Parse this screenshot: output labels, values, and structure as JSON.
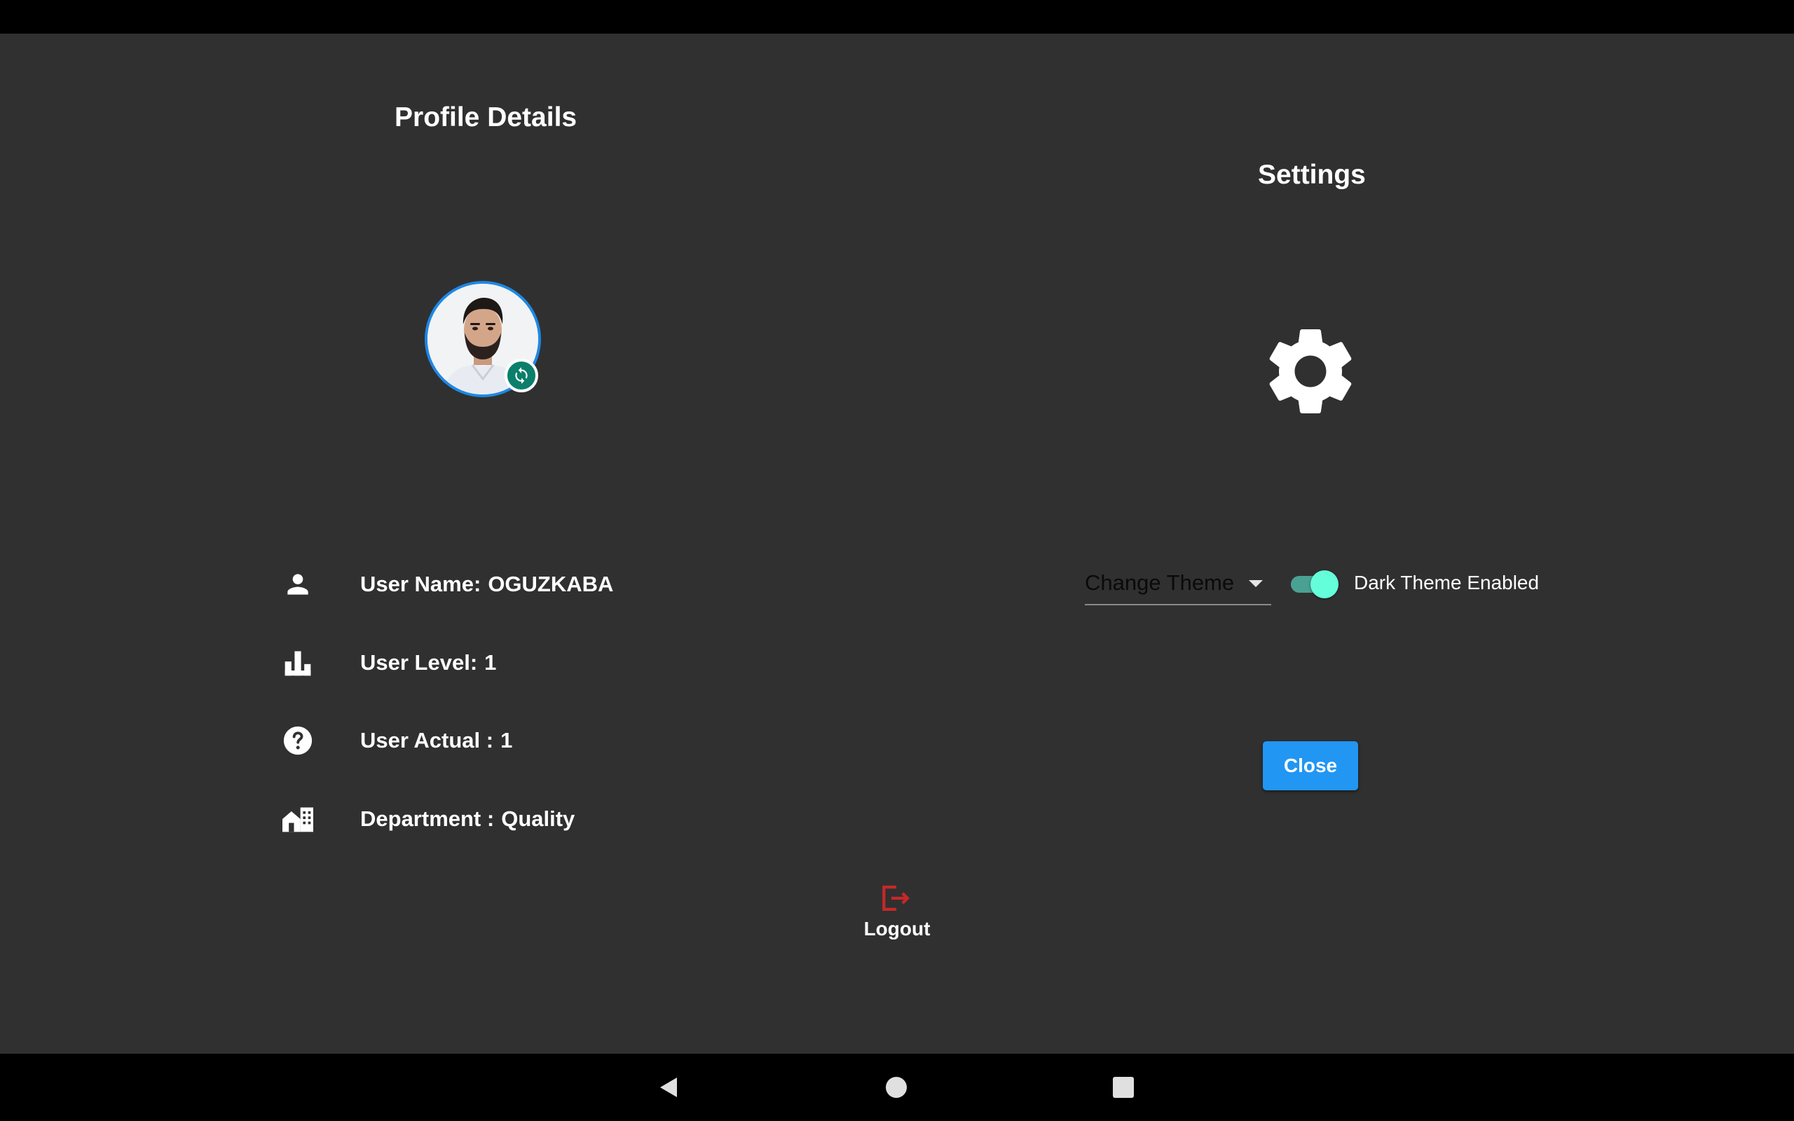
{
  "profile": {
    "title": "Profile Details",
    "user_name_label": "User Name:",
    "user_name_value": "OGUZKABA",
    "user_level_label": "User Level:",
    "user_level_value": "1",
    "user_actual_label": "User Actual :",
    "user_actual_value": "1",
    "department_label": "Department :",
    "department_value": "Quality"
  },
  "settings": {
    "title": "Settings",
    "theme_dropdown_label": "Change Theme",
    "dark_theme_label": "Dark Theme Enabled",
    "dark_theme_enabled": true,
    "close_label": "Close"
  },
  "logout": {
    "label": "Logout"
  },
  "icons": {
    "avatar": "avatar-photo",
    "sync": "sync-icon",
    "user": "person-icon",
    "level": "bar-chart-icon",
    "actual": "help-circle-icon",
    "department": "building-icon",
    "settings": "gear-icon",
    "logout": "logout-icon"
  },
  "colors": {
    "background": "#303030",
    "accent_blue": "#2196f3",
    "avatar_border": "#1e88e5",
    "sync_badge": "#0b7f6b",
    "toggle_thumb": "#64ffda",
    "toggle_track": "#4aa193",
    "logout_red": "#c62828"
  }
}
